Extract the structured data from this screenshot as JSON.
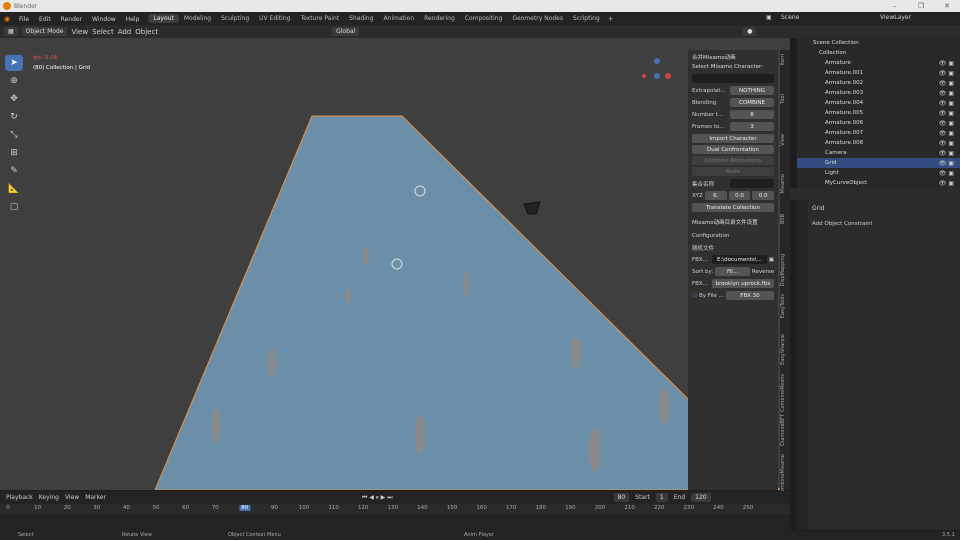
{
  "window": {
    "title": "Blender",
    "version": "3.5.1"
  },
  "menu": [
    "File",
    "Edit",
    "Render",
    "Window",
    "Help"
  ],
  "workspaces": [
    "Layout",
    "Modeling",
    "Sculpting",
    "UV Editing",
    "Texture Paint",
    "Shading",
    "Animation",
    "Rendering",
    "Compositing",
    "Geometry Nodes",
    "Scripting"
  ],
  "active_workspace": "Layout",
  "scene": "Scene",
  "viewlayer": "ViewLayer",
  "header": {
    "mode": "Object Mode",
    "menus": [
      "View",
      "Select",
      "Add",
      "Object"
    ],
    "orientation": "Global",
    "options": "Options"
  },
  "viewport": {
    "fps": "fps: 5.04",
    "info": "(80) Collection | Grid"
  },
  "npanel": {
    "section1": "合并Mixamo动画",
    "select_label": "Select Mixamo Character:",
    "extrapolation_label": "Extrapolat...",
    "extrapolation": "NOTHING",
    "blending_label": "Blending",
    "blending": "COMBINE",
    "number_label": "Number t...",
    "number": "8",
    "frames_label": "Frames to...",
    "frames": "3",
    "import_btn": "Import Character",
    "dual_btn": "Dual Confrontation",
    "combine_btn": "Combine Animations",
    "bake_btn": "Bake",
    "collection_label": "集合名称",
    "xyz_label": "XYZ",
    "x": "6.",
    "y": "0.0",
    "z": "0.0",
    "translate_btn": "Translate Collection",
    "section2": "Mixamo动画目录文件设置",
    "config": "Configuration",
    "random": "随机文件",
    "fbx_dir_label": "FBX...",
    "fbx_dir": "E:\\documents\\...",
    "sort_label": "Sort by:",
    "sort": "Fil...",
    "reverse": "Reverse",
    "fbx_file_label": "FBX...",
    "fbx_file": "brooklyn uprock.fbx",
    "byfile": "By File ...",
    "fbx_count": "FBX  30"
  },
  "vtabs": [
    "Item",
    "Tool",
    "View",
    "Mixamo",
    "BSB",
    "DispMapping",
    "EasyTools",
    "EasySharpie",
    "CombineMeshs",
    "DiamondBFT",
    "CombineMixamo"
  ],
  "outliner": {
    "root": "Scene Collection",
    "collection": "Collection",
    "items": [
      "Armature",
      "Armature.001",
      "Armature.002",
      "Armature.003",
      "Armature.004",
      "Armature.005",
      "Armature.006",
      "Armature.007",
      "Armature.008",
      "Camera",
      "Grid",
      "Light",
      "MyCurveObject"
    ],
    "selected": "Grid"
  },
  "properties": {
    "object": "Grid",
    "add_constraint": "Add Object Constraint"
  },
  "timeline": {
    "menus": [
      "Playback",
      "Keying",
      "View",
      "Marker"
    ],
    "frame": "80",
    "start_label": "Start",
    "start": "1",
    "end_label": "End",
    "end": "120",
    "ticks": [
      "0",
      "10",
      "20",
      "30",
      "40",
      "50",
      "60",
      "70",
      "80",
      "90",
      "100",
      "110",
      "120",
      "130",
      "140",
      "150",
      "160",
      "170",
      "180",
      "190",
      "200",
      "210",
      "220",
      "230",
      "240",
      "250"
    ]
  },
  "status": {
    "select": "Select",
    "rotate": "Rotate View",
    "context": "Object Context Menu",
    "anim": "Anim Player"
  },
  "colors": {
    "accent": "#4772b3",
    "plane": "#6b8fa8",
    "outline": "#e8944a"
  }
}
